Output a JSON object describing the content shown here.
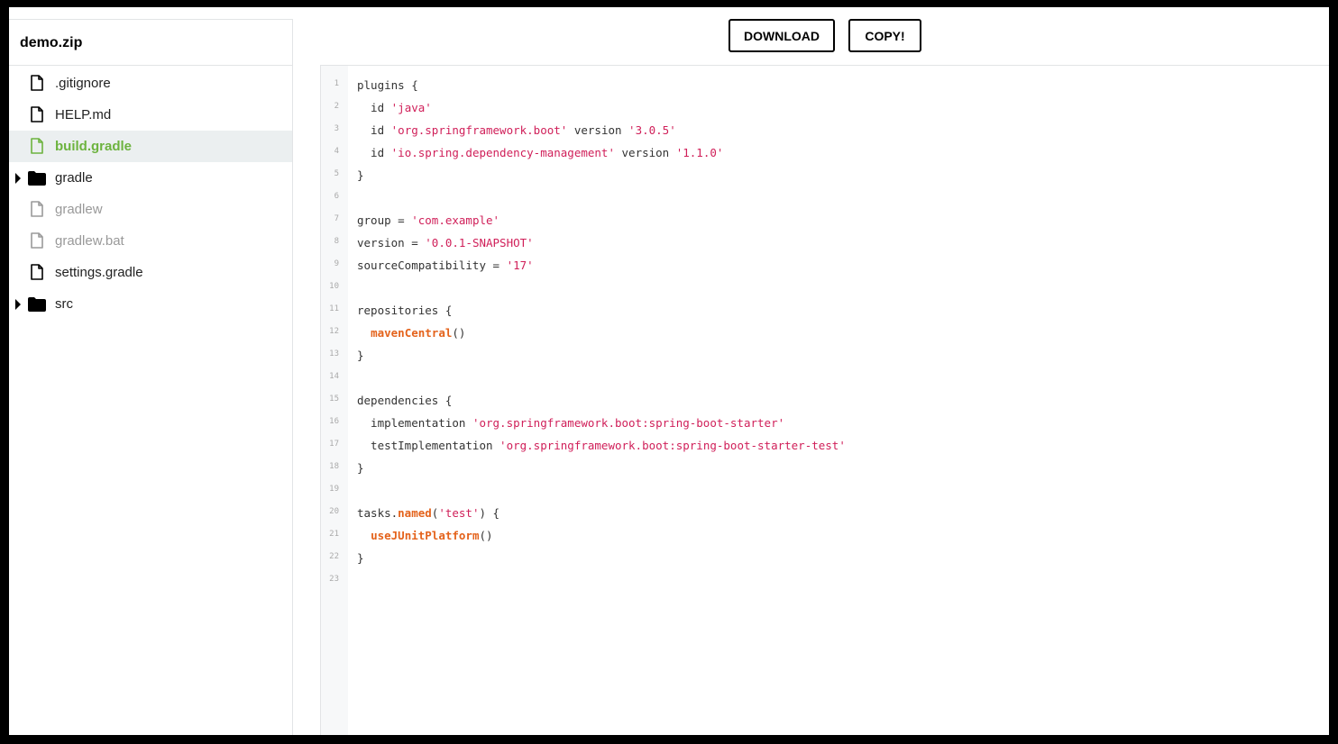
{
  "sidebar": {
    "title": "demo.zip",
    "items": [
      {
        "label": ".gitignore",
        "type": "file",
        "state": "normal"
      },
      {
        "label": "HELP.md",
        "type": "file",
        "state": "normal"
      },
      {
        "label": "build.gradle",
        "type": "file",
        "state": "selected"
      },
      {
        "label": "gradle",
        "type": "folder",
        "state": "normal"
      },
      {
        "label": "gradlew",
        "type": "file",
        "state": "muted"
      },
      {
        "label": "gradlew.bat",
        "type": "file",
        "state": "muted"
      },
      {
        "label": "settings.gradle",
        "type": "file",
        "state": "normal"
      },
      {
        "label": "src",
        "type": "folder",
        "state": "normal"
      }
    ]
  },
  "toolbar": {
    "download_label": "DOWNLOAD",
    "copy_label": "COPY!"
  },
  "colors": {
    "selected_text": "#6db33f",
    "selected_bg": "#ebeff0",
    "string": "#d01f59",
    "function": "#e4631c"
  },
  "editor": {
    "lines": [
      [
        {
          "t": "plugins {"
        }
      ],
      [
        {
          "t": "  id "
        },
        {
          "t": "'java'",
          "c": "s"
        }
      ],
      [
        {
          "t": "  id "
        },
        {
          "t": "'org.springframework.boot'",
          "c": "s"
        },
        {
          "t": " version "
        },
        {
          "t": "'3.0.5'",
          "c": "s"
        }
      ],
      [
        {
          "t": "  id "
        },
        {
          "t": "'io.spring.dependency-management'",
          "c": "s"
        },
        {
          "t": " version "
        },
        {
          "t": "'1.1.0'",
          "c": "s"
        }
      ],
      [
        {
          "t": "}"
        }
      ],
      [],
      [
        {
          "t": "group = "
        },
        {
          "t": "'com.example'",
          "c": "s"
        }
      ],
      [
        {
          "t": "version = "
        },
        {
          "t": "'0.0.1-SNAPSHOT'",
          "c": "s"
        }
      ],
      [
        {
          "t": "sourceCompatibility = "
        },
        {
          "t": "'17'",
          "c": "s"
        }
      ],
      [],
      [
        {
          "t": "repositories {"
        }
      ],
      [
        {
          "t": "  "
        },
        {
          "t": "mavenCentral",
          "c": "f"
        },
        {
          "t": "()"
        }
      ],
      [
        {
          "t": "}"
        }
      ],
      [],
      [
        {
          "t": "dependencies {"
        }
      ],
      [
        {
          "t": "  implementation "
        },
        {
          "t": "'org.springframework.boot:spring-boot-starter'",
          "c": "s"
        }
      ],
      [
        {
          "t": "  testImplementation "
        },
        {
          "t": "'org.springframework.boot:spring-boot-starter-test'",
          "c": "s"
        }
      ],
      [
        {
          "t": "}"
        }
      ],
      [],
      [
        {
          "t": "tasks."
        },
        {
          "t": "named",
          "c": "f"
        },
        {
          "t": "("
        },
        {
          "t": "'test'",
          "c": "s"
        },
        {
          "t": ") {"
        }
      ],
      [
        {
          "t": "  "
        },
        {
          "t": "useJUnitPlatform",
          "c": "f"
        },
        {
          "t": "()"
        }
      ],
      [
        {
          "t": "}"
        }
      ],
      []
    ]
  }
}
